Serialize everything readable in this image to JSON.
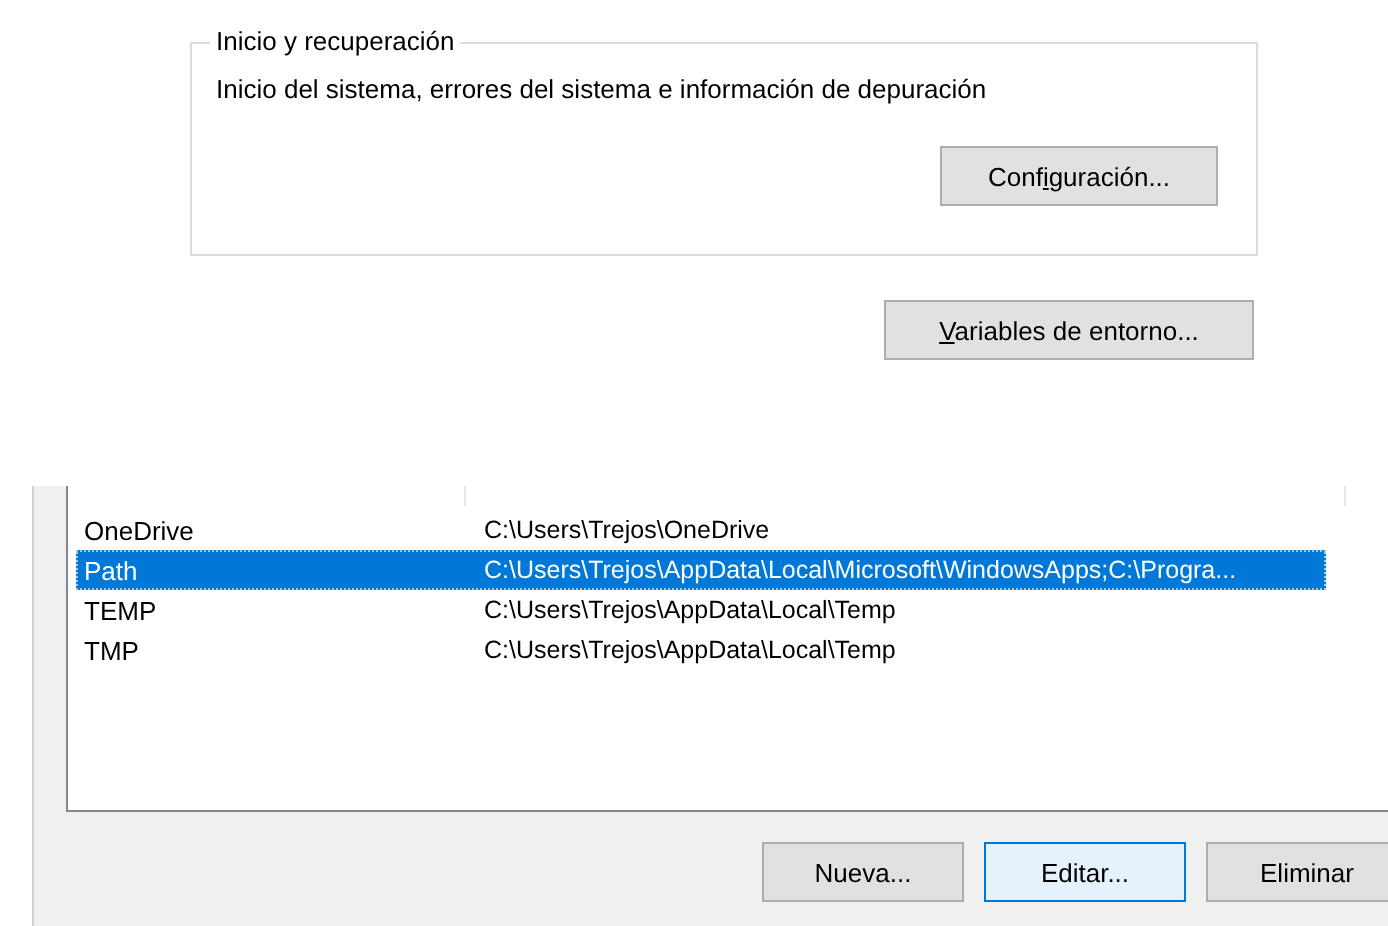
{
  "startup_recovery": {
    "title": "Inicio y recuperación",
    "description": "Inicio del sistema, errores del sistema e información de depuración",
    "button": {
      "label": "Configuración..."
    }
  },
  "environment_button": {
    "label": "Variables de entorno..."
  },
  "variables_table": {
    "rows": [
      {
        "name": "OneDrive",
        "value": "C:\\Users\\Trejos\\OneDrive",
        "selected": false
      },
      {
        "name": "Path",
        "value": "C:\\Users\\Trejos\\AppData\\Local\\Microsoft\\WindowsApps;C:\\Progra...",
        "selected": true
      },
      {
        "name": "TEMP",
        "value": "C:\\Users\\Trejos\\AppData\\Local\\Temp",
        "selected": false
      },
      {
        "name": "TMP",
        "value": "C:\\Users\\Trejos\\AppData\\Local\\Temp",
        "selected": false
      }
    ]
  },
  "buttons": [
    {
      "label": "Nueva...",
      "focused": false
    },
    {
      "label": "Editar...",
      "focused": true
    },
    {
      "label": "Eliminar",
      "focused": false
    }
  ]
}
